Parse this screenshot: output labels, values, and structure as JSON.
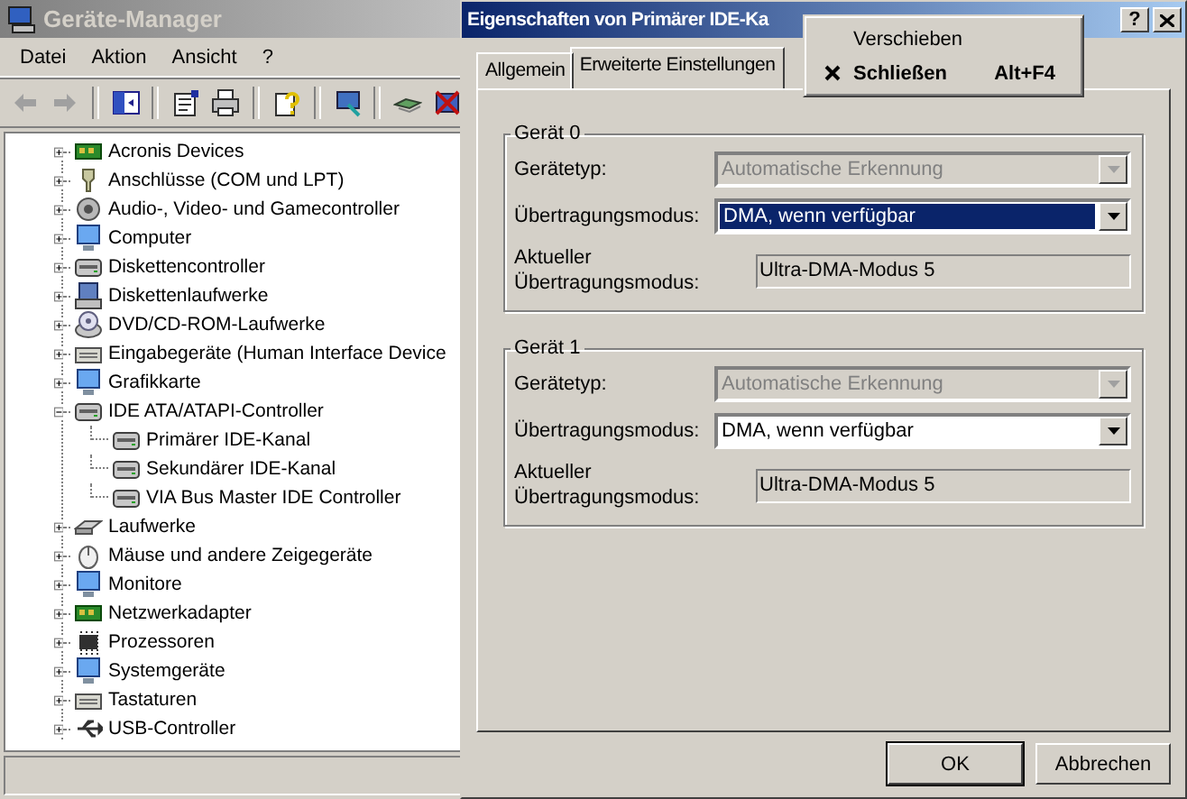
{
  "device_manager": {
    "title": "Geräte-Manager",
    "active": false,
    "menu": [
      "Datei",
      "Aktion",
      "Ansicht",
      "?"
    ],
    "toolbar": [
      {
        "kind": "back",
        "disabled": true
      },
      {
        "kind": "forward",
        "disabled": true
      },
      {
        "kind": "sep"
      },
      {
        "kind": "pane"
      },
      {
        "kind": "sep"
      },
      {
        "kind": "properties"
      },
      {
        "kind": "print"
      },
      {
        "kind": "sep"
      },
      {
        "kind": "help"
      },
      {
        "kind": "sep"
      },
      {
        "kind": "scan"
      },
      {
        "kind": "sep"
      },
      {
        "kind": "update"
      },
      {
        "kind": "uninstall"
      }
    ],
    "tree": [
      {
        "label": "Acronis Devices",
        "kind": "board",
        "expanded": false
      },
      {
        "label": "Anschlüsse (COM und LPT)",
        "kind": "port",
        "expanded": false
      },
      {
        "label": "Audio-, Video- und Gamecontroller",
        "kind": "speaker",
        "expanded": false
      },
      {
        "label": "Computer",
        "kind": "computer",
        "expanded": false
      },
      {
        "label": "Diskettencontroller",
        "kind": "controller",
        "expanded": false
      },
      {
        "label": "Diskettenlaufwerke",
        "kind": "floppy",
        "expanded": false
      },
      {
        "label": "DVD/CD-ROM-Laufwerke",
        "kind": "disc",
        "expanded": false
      },
      {
        "label": "Eingabegeräte (Human Interface Device",
        "kind": "keyboard",
        "expanded": false
      },
      {
        "label": "Grafikkarte",
        "kind": "computer",
        "expanded": false
      },
      {
        "label": "IDE ATA/ATAPI-Controller",
        "kind": "controller",
        "expanded": true,
        "children": [
          {
            "label": "Primärer IDE-Kanal",
            "kind": "controller"
          },
          {
            "label": "Sekundärer IDE-Kanal",
            "kind": "controller"
          },
          {
            "label": "VIA Bus Master IDE Controller",
            "kind": "controller"
          }
        ]
      },
      {
        "label": "Laufwerke",
        "kind": "drive",
        "expanded": false
      },
      {
        "label": "Mäuse und andere Zeigegeräte",
        "kind": "mouse",
        "expanded": false
      },
      {
        "label": "Monitore",
        "kind": "computer",
        "expanded": false
      },
      {
        "label": "Netzwerkadapter",
        "kind": "board",
        "expanded": false
      },
      {
        "label": "Prozessoren",
        "kind": "cpu",
        "expanded": false
      },
      {
        "label": "Systemgeräte",
        "kind": "computer",
        "expanded": false
      },
      {
        "label": "Tastaturen",
        "kind": "keyboard",
        "expanded": false
      },
      {
        "label": "USB-Controller",
        "kind": "usb",
        "expanded": false
      }
    ]
  },
  "dialog": {
    "title": "Eigenschaften von Primärer IDE-Ka",
    "active": true,
    "help_button": "?",
    "tabs": [
      {
        "label": "Allgemein",
        "selected": false
      },
      {
        "label": "Erweiterte Einstellungen",
        "selected": true
      }
    ],
    "groups": [
      {
        "title": "Gerät 0",
        "fields": [
          {
            "kind": "combo",
            "label": "Gerätetyp:",
            "value": "Automatische Erkennung",
            "disabled": true,
            "focused": false
          },
          {
            "kind": "combo",
            "label": "Übertragungsmodus:",
            "value": "DMA, wenn verfügbar",
            "disabled": false,
            "focused": true
          },
          {
            "kind": "readonly",
            "label": "Aktueller Übertragungsmodus:",
            "value": "Ultra-DMA-Modus 5"
          }
        ]
      },
      {
        "title": "Gerät 1",
        "fields": [
          {
            "kind": "combo",
            "label": "Gerätetyp:",
            "value": "Automatische Erkennung",
            "disabled": true,
            "focused": false
          },
          {
            "kind": "combo",
            "label": "Übertragungsmodus:",
            "value": "DMA, wenn verfügbar",
            "disabled": false,
            "focused": false
          },
          {
            "kind": "readonly",
            "label": "Aktueller Übertragungsmodus:",
            "value": "Ultra-DMA-Modus 5"
          }
        ]
      }
    ],
    "buttons": [
      {
        "label": "OK",
        "default": true
      },
      {
        "label": "Abbrechen",
        "default": false
      }
    ]
  },
  "context_menu": {
    "items": [
      {
        "label": "Verschieben",
        "kind": "plain",
        "default": false
      },
      {
        "label": "Schließen",
        "kind": "close",
        "default": true,
        "shortcut": "Alt+F4"
      }
    ]
  }
}
